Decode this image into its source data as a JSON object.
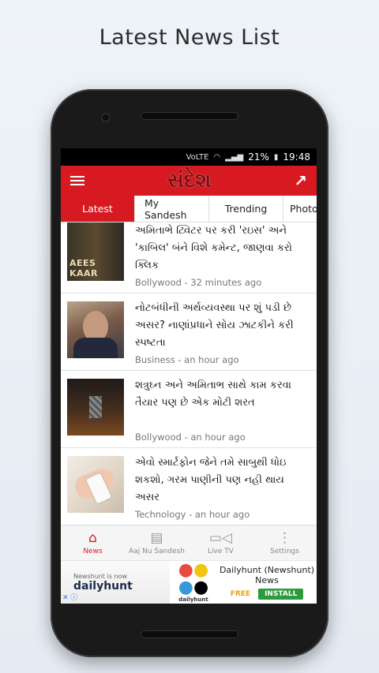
{
  "promo": {
    "headline": "Latest News List"
  },
  "status": {
    "network": "VoLTE",
    "battery": "21%",
    "time": "19:48"
  },
  "appbar": {
    "logo": "સંદેશ"
  },
  "tabs": [
    {
      "label": "Latest"
    },
    {
      "label": "My Sandesh"
    },
    {
      "label": "Trending"
    },
    {
      "label": "Photo"
    }
  ],
  "articles": [
    {
      "title": "અમિતાભે ટ્વિટર પર કરી 'રઇસ' અને 'કાબિલ' બંને વિશે કમેન્ટ, જાણવા કરો ક્લિક",
      "meta": "Bollywood - 32 minutes ago",
      "thumb_label": "AEES KAAR"
    },
    {
      "title": "નોટબંધીની અર્થવ્યવસ્થા પર શું પડી છે અસર? નાણાંપ્રધાને સોય ઝાટકીને કરી સ્પષ્ટતા",
      "meta": "Business - an hour ago"
    },
    {
      "title": "શત્રુઘ્ન અને અમિતાભ સાથે કામ કરવા તૈયાર પણ છે એક મોટી શરત",
      "meta": "Bollywood - an hour ago"
    },
    {
      "title": "એવો સ્માર્ટફોન જેને તમે સાબુથી ધોઇ શકશો, ગરમ પાણીની પણ નહી થાય અસર",
      "meta": "Technology - an hour ago"
    }
  ],
  "bottomnav": [
    {
      "label": "News",
      "icon": "home-icon"
    },
    {
      "label": "Aaj Nu Sandesh",
      "icon": "newspaper-icon"
    },
    {
      "label": "Live TV",
      "icon": "video-camera-icon"
    },
    {
      "label": "Settings",
      "icon": "more-vertical-icon"
    }
  ],
  "ad": {
    "small": "Newshunt is now",
    "brand": "dailyhunt",
    "logo_caption": "dailyhunt",
    "title": "Dailyhunt (Newshunt) News",
    "price": "FREE",
    "install": "INSTALL",
    "adchoices": "✕ ⓘ"
  },
  "colors": {
    "brand_red": "#d71a21",
    "logo": "#7b0c10"
  }
}
